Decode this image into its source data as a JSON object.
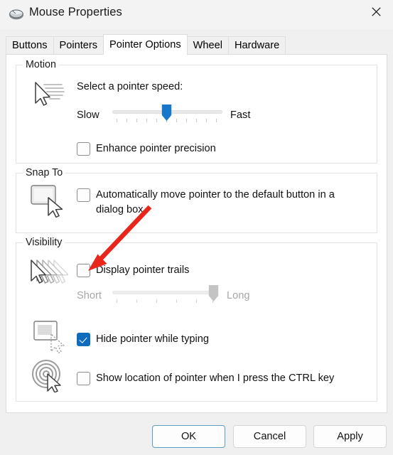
{
  "window": {
    "title": "Mouse Properties",
    "icon": "mouse-icon",
    "close_label": "Close"
  },
  "tabs": [
    {
      "id": "buttons",
      "label": "Buttons",
      "active": false
    },
    {
      "id": "pointers",
      "label": "Pointers",
      "active": false
    },
    {
      "id": "pointer-options",
      "label": "Pointer Options",
      "active": true
    },
    {
      "id": "wheel",
      "label": "Wheel",
      "active": false
    },
    {
      "id": "hardware",
      "label": "Hardware",
      "active": false
    }
  ],
  "groups": {
    "motion": {
      "label": "Motion",
      "speed_caption": "Select a pointer speed:",
      "slider": {
        "min_label": "Slow",
        "max_label": "Fast",
        "ticks": 11,
        "value": 6,
        "enabled": true
      },
      "enhance_precision": {
        "label": "Enhance pointer precision",
        "checked": false
      }
    },
    "snap_to": {
      "label": "Snap To",
      "auto_move": {
        "label": "Automatically move pointer to the default button in a dialog box",
        "checked": false
      }
    },
    "visibility": {
      "label": "Visibility",
      "display_trails": {
        "label": "Display pointer trails",
        "checked": false
      },
      "trails_slider": {
        "min_label": "Short",
        "max_label": "Long",
        "ticks": 6,
        "value": 6,
        "enabled": false
      },
      "hide_while_typing": {
        "label": "Hide pointer while typing",
        "checked": true
      },
      "show_location": {
        "label": "Show location of pointer when I press the CTRL key",
        "checked": false
      }
    }
  },
  "footer": {
    "ok": "OK",
    "cancel": "Cancel",
    "apply": "Apply"
  },
  "colors": {
    "accent": "#0f6cbd",
    "slider_thumb": "#1877c9",
    "slider_thumb_disabled": "#c4c4c4",
    "annotation": "#e8261c",
    "window_bg": "#f0f0f0",
    "panel_bg": "#ffffff"
  },
  "annotation": {
    "type": "arrow",
    "color": "#e8261c",
    "points_to": "display-pointer-trails-checkbox"
  }
}
